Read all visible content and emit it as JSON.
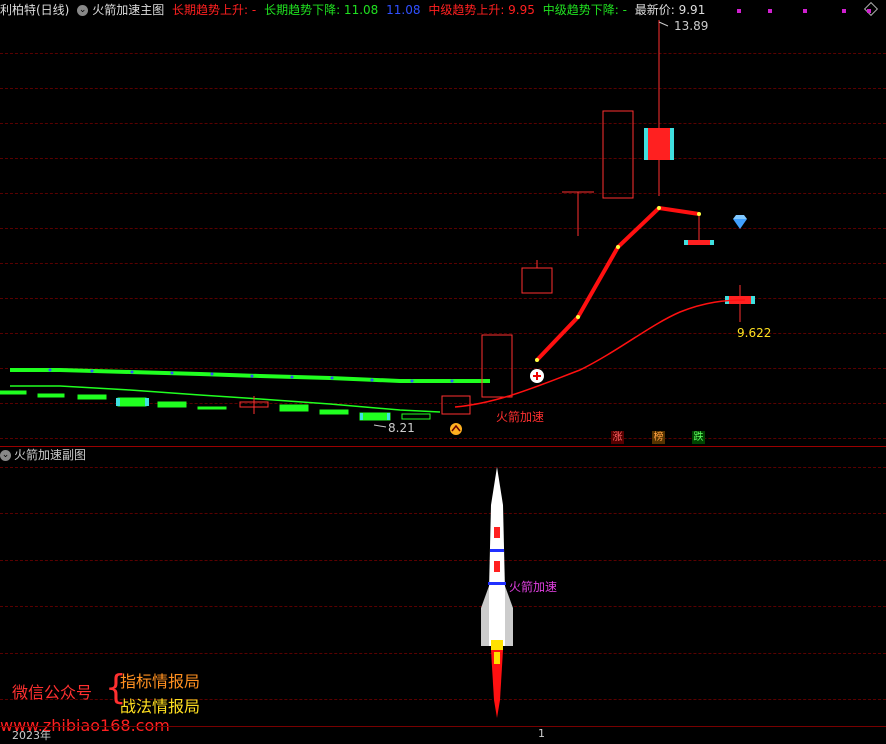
{
  "header": {
    "stock_name": "利柏特(日线)",
    "indicator": "火箭加速主图",
    "long_up_label": "长期趋势上升: -",
    "long_down_label": "长期趋势下降: 11.08",
    "long_down_value2": "11.08",
    "mid_up_label": "中级趋势上升: 9.95",
    "mid_down_label": "中级趋势下降: -",
    "latest_label": "最新价: 9.91",
    "colors": {
      "up": "#ff2020",
      "down": "#20e020",
      "blue": "#2040ff",
      "white": "#cccccc"
    }
  },
  "main_chart": {
    "high_label": "13.89",
    "low_label": "8.21",
    "ma_label": "9.622",
    "rocket_text": "火箭加速",
    "badges": [
      "涨",
      "榜",
      "跌"
    ]
  },
  "sub_panel": {
    "title": "火箭加速副图",
    "rocket_text": "火箭加速"
  },
  "watermark": {
    "line1": "微信公众号",
    "brand1": "指标情报局",
    "brand2": "战法情报局",
    "url": "www.zhibiao168.com"
  },
  "footer": {
    "year": "2023年",
    "marker": "1"
  }
}
